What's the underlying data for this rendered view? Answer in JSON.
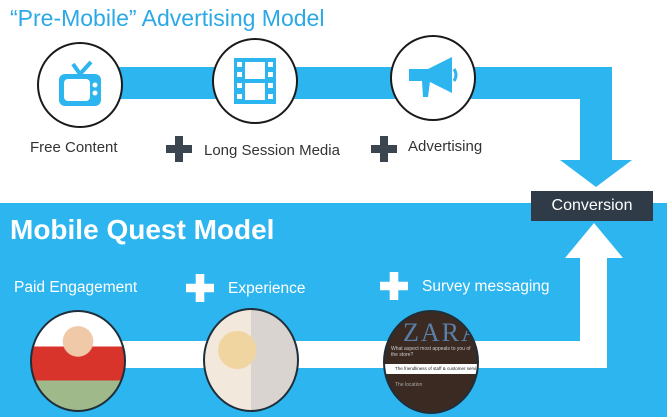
{
  "top": {
    "title": "“Pre-Mobile” Advertising Model",
    "steps": [
      {
        "label": "Free Content",
        "icon": "tv-icon"
      },
      {
        "label": "Long Session Media",
        "icon": "film-icon"
      },
      {
        "label": "Advertising",
        "icon": "megaphone-icon"
      }
    ]
  },
  "conversion": "Conversion",
  "bottom": {
    "title": "Mobile Quest Model",
    "steps": [
      {
        "label": "Paid Engagement",
        "image": "people-holding-cash-photo"
      },
      {
        "label": "Experience",
        "image": "woman-smelling-perfume-photo"
      },
      {
        "label": "Survey messaging",
        "image": "survey-on-store-photo"
      }
    ],
    "survey_lines": [
      "What aspect most appeals to you of the store?",
      "The friendliness of staff & customer service",
      "The location"
    ],
    "store_sign": "ZARA"
  },
  "colors": {
    "accent": "#2db5ef",
    "dark": "#2f3b47",
    "plus_dark": "#3a4550"
  }
}
